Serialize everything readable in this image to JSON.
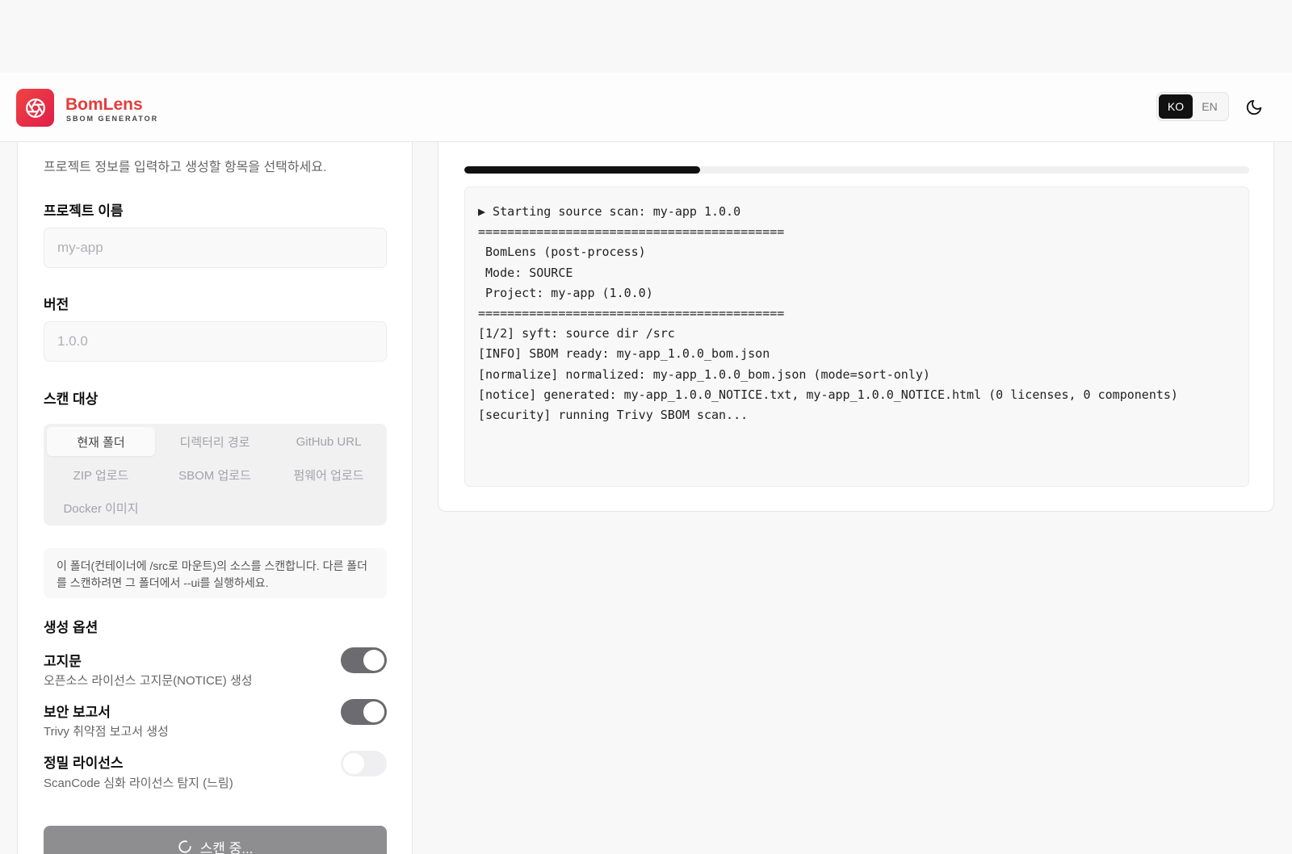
{
  "header": {
    "brand_name": "BomLens",
    "brand_sub": "SBOM GENERATOR",
    "lang_options": [
      "KO",
      "EN"
    ],
    "active_lang": "KO",
    "theme_icon": "moon-icon"
  },
  "form": {
    "description": "프로젝트 정보를 입력하고 생성할 항목을 선택하세요.",
    "project_name_label": "프로젝트 이름",
    "project_name_placeholder": "my-app",
    "version_label": "버전",
    "version_placeholder": "1.0.0",
    "scan_target_label": "스캔 대상",
    "scan_targets": [
      "현재 폴더",
      "디렉터리 경로",
      "GitHub URL",
      "ZIP 업로드",
      "SBOM 업로드",
      "펌웨어 업로드",
      "Docker 이미지"
    ],
    "active_scan_target": "현재 폴더",
    "info_text": "이 폴더(컨테이너에 /src로 마운트)의 소스를 스캔합니다. 다른 폴더를 스캔하려면 그 폴더에서 --ui를 실행하세요.",
    "options_label": "생성 옵션",
    "options": [
      {
        "title": "고지문",
        "desc": "오픈소스 라이선스 고지문(NOTICE) 생성",
        "on": true
      },
      {
        "title": "보안 보고서",
        "desc": "Trivy 취약점 보고서 생성",
        "on": true
      },
      {
        "title": "정밀 라이선스",
        "desc": "ScanCode 심화 라이선스 탐지 (느림)",
        "on": false
      }
    ],
    "scan_button_label": "스캔 중..."
  },
  "log": {
    "progress_fraction": 0.3,
    "lines": [
      "▶ Starting source scan: my-app 1.0.0",
      "==========================================",
      " BomLens (post-process)",
      " Mode: SOURCE",
      " Project: my-app (1.0.0)",
      "==========================================",
      "[1/2] syft: source dir /src",
      "[INFO] SBOM ready: my-app_1.0.0_bom.json",
      "[normalize] normalized: my-app_1.0.0_bom.json (mode=sort-only)",
      "[notice] generated: my-app_1.0.0_NOTICE.txt, my-app_1.0.0_NOTICE.html (0 licenses, 0 components)",
      "[security] running Trivy SBOM scan..."
    ]
  }
}
